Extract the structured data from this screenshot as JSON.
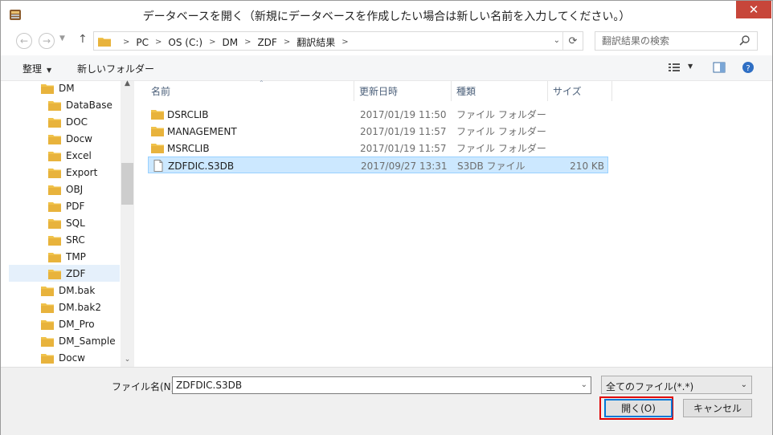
{
  "window": {
    "title": "データベースを開く（新規にデータベースを作成したい場合は新しい名前を入力してください。）",
    "close_glyph": "✕"
  },
  "nav": {
    "back_glyph": "←",
    "forward_glyph": "→",
    "up_glyph": "↑",
    "breadcrumbs": [
      "PC",
      "OS (C:)",
      "DM",
      "ZDF",
      "翻訳結果"
    ],
    "search_placeholder": "翻訳結果の検索"
  },
  "toolbar": {
    "organize_label": "整理",
    "new_folder_label": "新しいフォルダー"
  },
  "tree": {
    "items": [
      {
        "label": "DM",
        "level": 0
      },
      {
        "label": "DataBase",
        "level": 1
      },
      {
        "label": "DOC",
        "level": 1
      },
      {
        "label": "Docw",
        "level": 1
      },
      {
        "label": "Excel",
        "level": 1
      },
      {
        "label": "Export",
        "level": 1
      },
      {
        "label": "OBJ",
        "level": 1
      },
      {
        "label": "PDF",
        "level": 1
      },
      {
        "label": "SQL",
        "level": 1
      },
      {
        "label": "SRC",
        "level": 1
      },
      {
        "label": "TMP",
        "level": 1
      },
      {
        "label": "ZDF",
        "level": 1,
        "selected": true
      },
      {
        "label": "DM.bak",
        "level": 0
      },
      {
        "label": "DM.bak2",
        "level": 0
      },
      {
        "label": "DM_Pro",
        "level": 0
      },
      {
        "label": "DM_Sample",
        "level": 0
      },
      {
        "label": "Docw",
        "level": 0
      }
    ]
  },
  "files": {
    "columns": {
      "name": "名前",
      "date": "更新日時",
      "type": "種類",
      "size": "サイズ"
    },
    "rows": [
      {
        "name": "DSRCLIB",
        "date": "2017/01/19 11:50",
        "type": "ファイル フォルダー",
        "size": "",
        "kind": "folder"
      },
      {
        "name": "MANAGEMENT",
        "date": "2017/01/19 11:57",
        "type": "ファイル フォルダー",
        "size": "",
        "kind": "folder"
      },
      {
        "name": "MSRCLIB",
        "date": "2017/01/19 11:57",
        "type": "ファイル フォルダー",
        "size": "",
        "kind": "folder"
      },
      {
        "name": "ZDFDIC.S3DB",
        "date": "2017/09/27 13:31",
        "type": "S3DB ファイル",
        "size": "210 KB",
        "kind": "file",
        "selected": true
      }
    ]
  },
  "footer": {
    "filename_label": "ファイル名(N):",
    "filename_value": "ZDFDIC.S3DB",
    "filter_selected": "全てのファイル(*.*)",
    "open_label": "開く(O)",
    "cancel_label": "キャンセル"
  },
  "colors": {
    "selection_bg": "#cce8ff",
    "selection_border": "#99d1ff",
    "highlight_box": "#e00000",
    "folder_yellow": "#f0c24a"
  }
}
